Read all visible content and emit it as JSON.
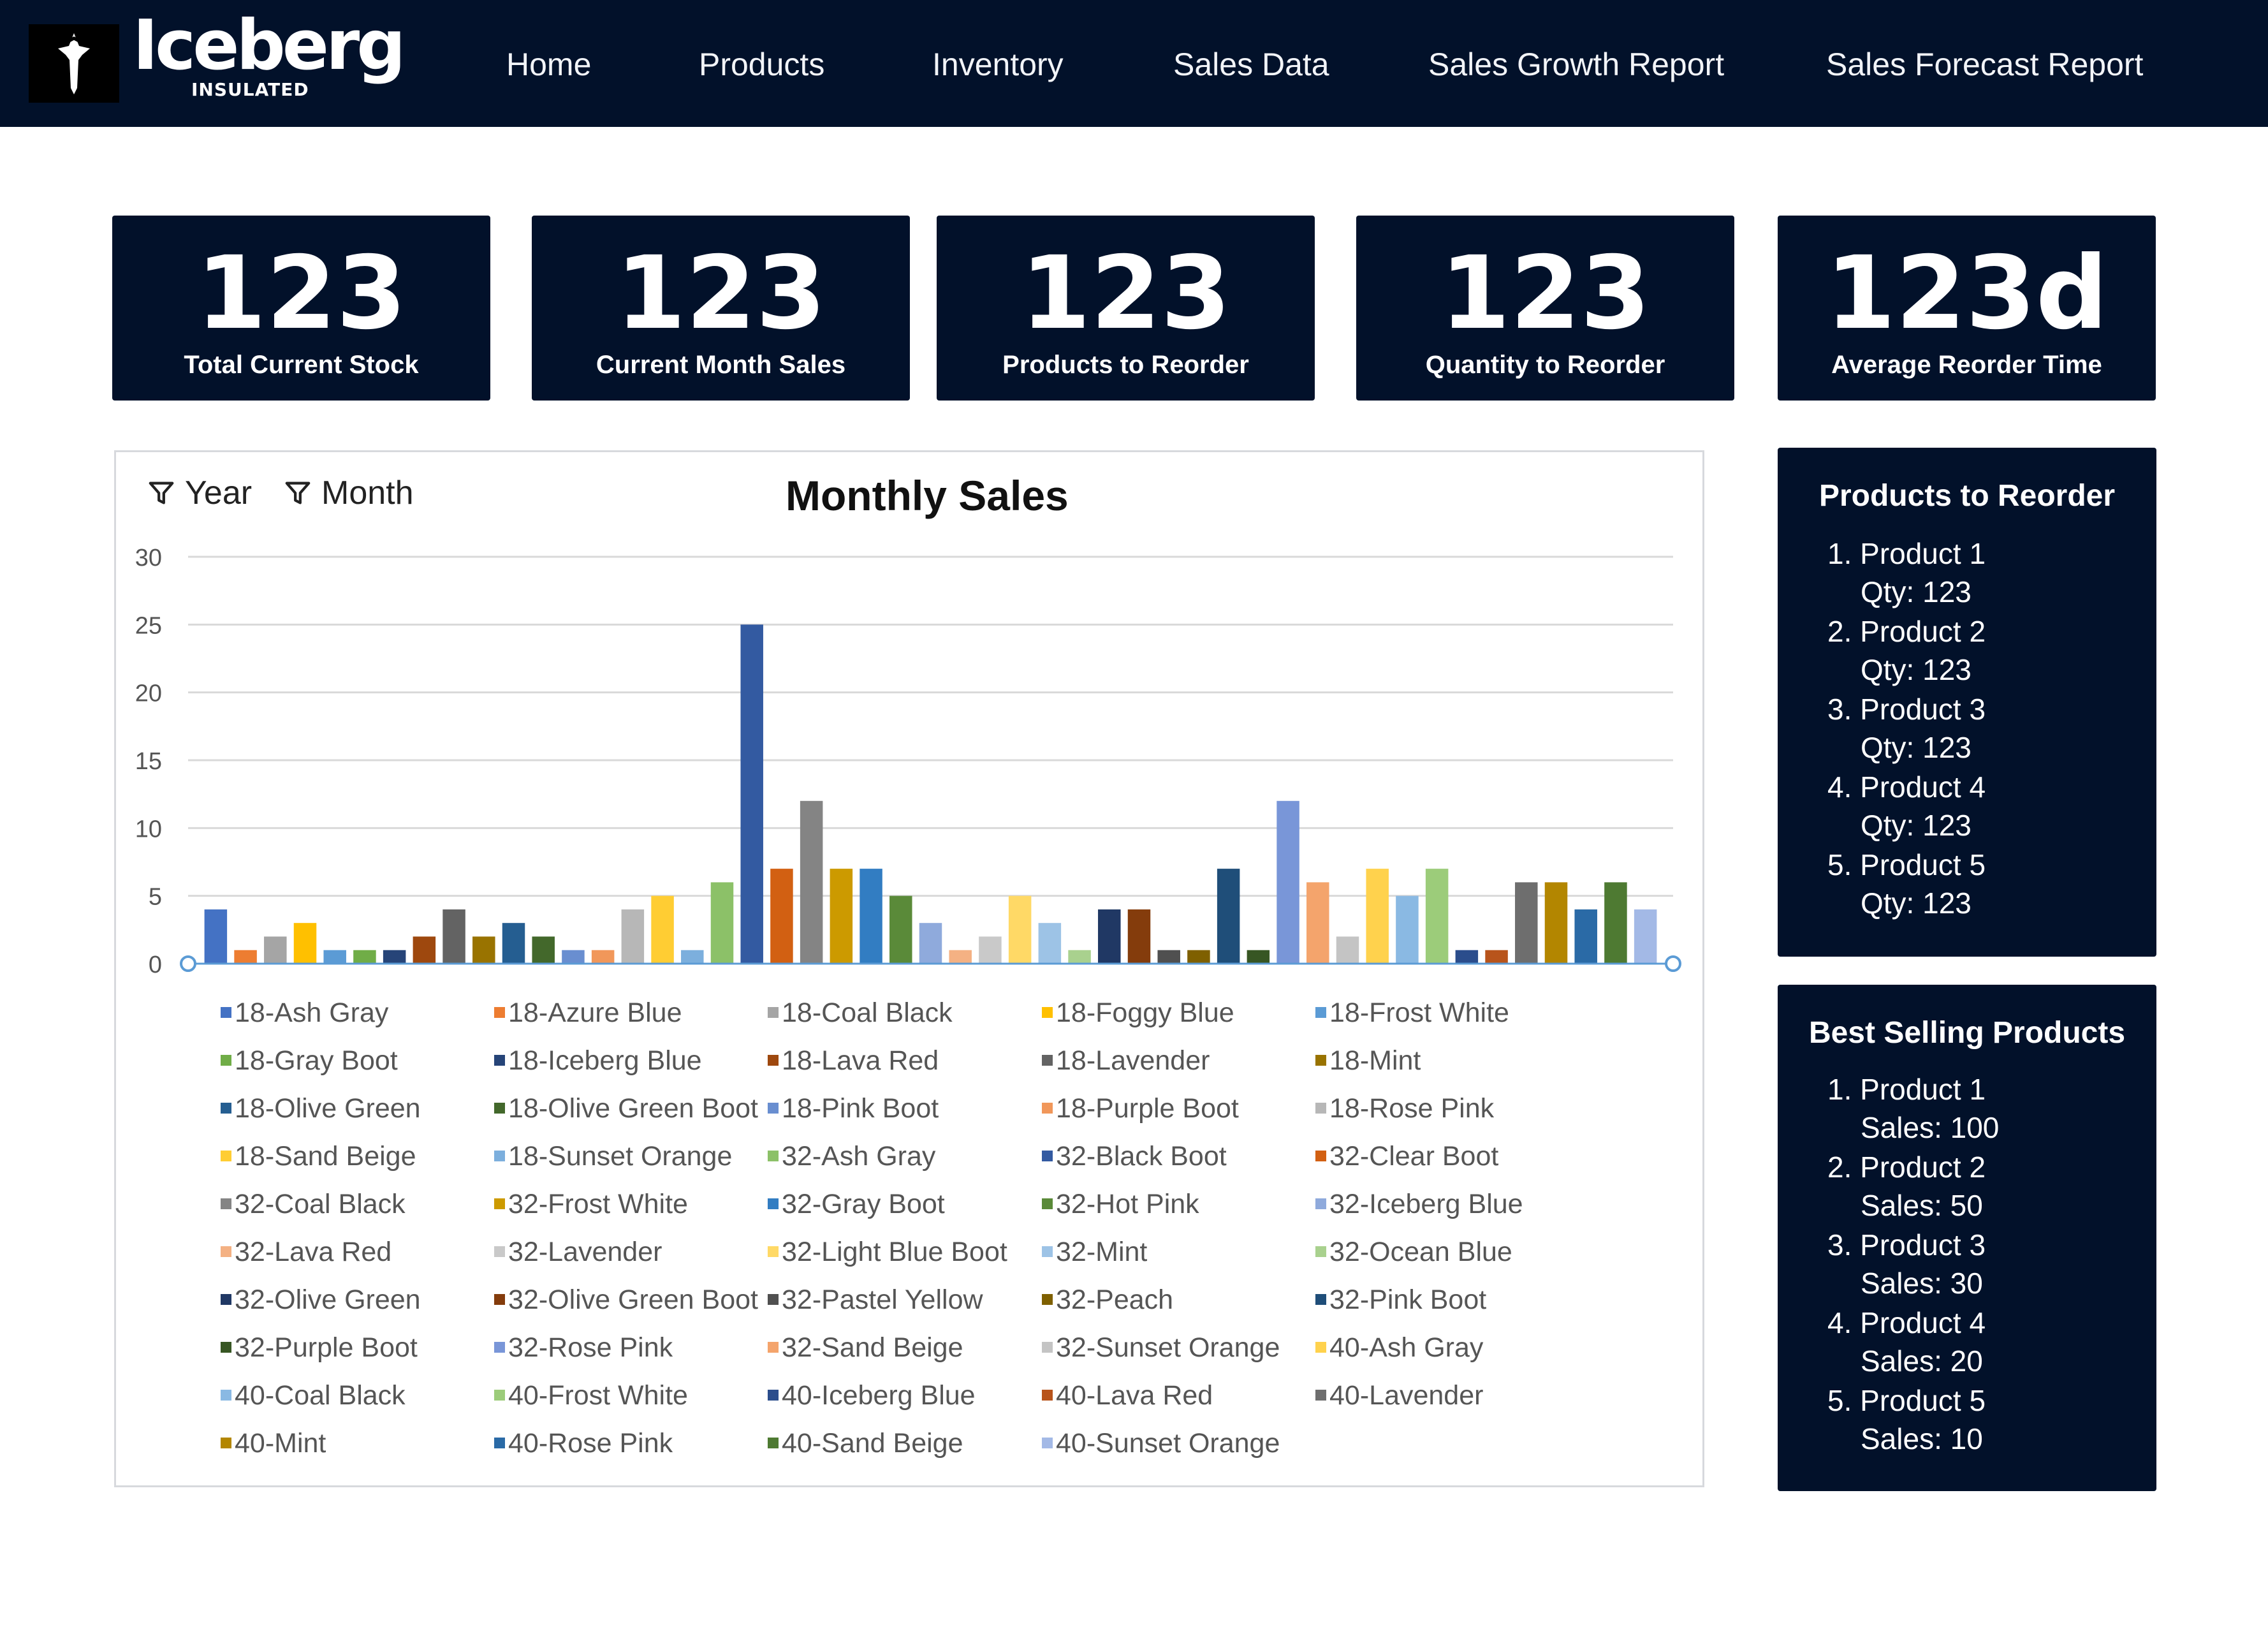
{
  "brand": {
    "name": "Iceberg",
    "tagline": "INSULATED",
    "logo_icon": "iceberg-figure-icon"
  },
  "nav": {
    "items": [
      "Home",
      "Products",
      "Inventory",
      "Sales Data",
      "Sales Growth Report",
      "Sales Forecast Report"
    ]
  },
  "kpis": [
    {
      "value": "123",
      "label": "Total Current Stock"
    },
    {
      "value": "123",
      "label": "Current Month Sales"
    },
    {
      "value": "123",
      "label": "Products to Reorder"
    },
    {
      "value": "123",
      "label": "Quantity to Reorder"
    },
    {
      "value": "123d",
      "label": "Average Reorder Time"
    }
  ],
  "filters": {
    "year": "Year",
    "month": "Month",
    "icon": "filter-icon"
  },
  "chart_data": {
    "type": "bar",
    "title": "Monthly Sales",
    "xlabel": "",
    "ylabel": "",
    "ylim": [
      0,
      30
    ],
    "yticks": [
      0,
      5,
      10,
      15,
      20,
      25,
      30
    ],
    "grid": true,
    "legend_position": "bottom",
    "categories": [
      "18-Ash Gray",
      "18-Azure Blue",
      "18-Coal Black",
      "18-Foggy Blue",
      "18-Frost White",
      "18-Gray Boot",
      "18-Iceberg Blue",
      "18-Lava Red",
      "18-Lavender",
      "18-Mint",
      "18-Olive Green",
      "18-Olive Green Boot",
      "18-Pink Boot",
      "18-Purple Boot",
      "18-Rose Pink",
      "18-Sand Beige",
      "18-Sunset Orange",
      "32-Ash Gray",
      "32-Black Boot",
      "32-Clear Boot",
      "32-Coal Black",
      "32-Frost White",
      "32-Gray Boot",
      "32-Hot Pink",
      "32-Iceberg Blue",
      "32-Lava Red",
      "32-Lavender",
      "32-Light Blue Boot",
      "32-Mint",
      "32-Ocean Blue",
      "32-Olive Green",
      "32-Olive Green Boot",
      "32-Pastel Yellow",
      "32-Peach",
      "32-Pink Boot",
      "32-Purple Boot",
      "32-Rose Pink",
      "32-Sand Beige",
      "32-Sunset Orange",
      "40-Ash Gray",
      "40-Coal Black",
      "40-Frost White",
      "40-Iceberg Blue",
      "40-Lava Red",
      "40-Lavender",
      "40-Mint",
      "40-Rose Pink",
      "40-Sand Beige",
      "40-Sunset Orange"
    ],
    "values": [
      4,
      1,
      2,
      3,
      1,
      1,
      1,
      2,
      4,
      2,
      3,
      2,
      1,
      1,
      4,
      5,
      1,
      6,
      25,
      7,
      12,
      7,
      7,
      5,
      3,
      1,
      2,
      5,
      3,
      1,
      4,
      4,
      1,
      1,
      7,
      1,
      12,
      6,
      2,
      7,
      5,
      7,
      1,
      1,
      6,
      6,
      4,
      6,
      4
    ],
    "colors": [
      "#4472c4",
      "#ed7d31",
      "#a5a5a5",
      "#ffc000",
      "#5b9bd5",
      "#70ad47",
      "#264478",
      "#9e480e",
      "#636363",
      "#997300",
      "#255e91",
      "#43682b",
      "#698ed0",
      "#f1975a",
      "#b7b7b7",
      "#ffcd33",
      "#7cafdd",
      "#8cc168",
      "#335aa1",
      "#d26012",
      "#848484",
      "#cc9a00",
      "#327dc2",
      "#5a8a39",
      "#8faadc",
      "#f4b183",
      "#c9c9c9",
      "#ffd966",
      "#9dc3e6",
      "#a9d18e",
      "#203864",
      "#843c0c",
      "#505050",
      "#7f6000",
      "#1f4e79",
      "#375623",
      "#7996d8",
      "#f4a46c",
      "#c4c4c4",
      "#ffd24d",
      "#8ab9e3",
      "#9ccc7a",
      "#2b4d8c",
      "#b8541b",
      "#6e6e6e",
      "#b38600",
      "#2a6aa6",
      "#4e7a32",
      "#a3b9e6"
    ]
  },
  "reorder_panel": {
    "title": "Products to Reorder",
    "items": [
      {
        "name": "1. Product 1",
        "detail": "Qty: 123"
      },
      {
        "name": "2. Product 2",
        "detail": "Qty: 123"
      },
      {
        "name": "3. Product 3",
        "detail": "Qty: 123"
      },
      {
        "name": "4. Product 4",
        "detail": "Qty: 123"
      },
      {
        "name": "5. Product 5",
        "detail": "Qty: 123"
      }
    ]
  },
  "best_selling_panel": {
    "title": "Best Selling Products",
    "items": [
      {
        "name": "1. Product 1",
        "detail": "Sales: 100"
      },
      {
        "name": "2. Product 2",
        "detail": "Sales: 50"
      },
      {
        "name": "3. Product 3",
        "detail": "Sales: 30"
      },
      {
        "name": "4. Product 4",
        "detail": "Sales: 20"
      },
      {
        "name": "5. Product 5",
        "detail": "Sales: 10"
      }
    ]
  }
}
